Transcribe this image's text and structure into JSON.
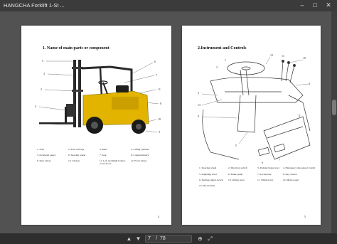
{
  "window": {
    "title": "HANGCHA Forklift 1-St ...",
    "minimize_glyph": "–",
    "maximize_glyph": "□",
    "close_glyph": "✕"
  },
  "left_page": {
    "heading": "1. Name of main parts or component",
    "legend": [
      "1. Fork",
      "2. Fork carriage",
      "3. Mast",
      "4. Lifting cylinder",
      "5. Overhead guard",
      "6. Steering wheel",
      "7. Seat",
      "8. Counterbalance",
      "9. Rear wheel",
      "10. Chassis",
      "11. Left and Right battery cover hood",
      "12. Front wheel"
    ],
    "page_number": "4"
  },
  "right_page": {
    "heading": "2.Instrument and Controls",
    "legend": [
      "1. Steering wheel",
      "2. Direction switch",
      "3. Parking brake lever",
      "4. Emergency disconnect switch",
      "5. Adjusting lever",
      "6. Brake pedal",
      "7. Accelerator",
      "8. Key switch",
      "9. Turning signal switch",
      "10. Lifting lever",
      "11. Tilting lever",
      "12. Meter panel",
      "13. Horn button"
    ],
    "page_number": "5"
  },
  "toolbar": {
    "current_page": "7",
    "slash": "/",
    "total_pages": "78",
    "prev_glyph": "▲",
    "next_glyph": "▼",
    "zoom_glyph": "⊕",
    "fit_glyph": "⤢"
  },
  "colors": {
    "forklift_body": "#e2b400",
    "forklift_dark": "#2a2a2a",
    "viewer_bg": "#525252"
  }
}
